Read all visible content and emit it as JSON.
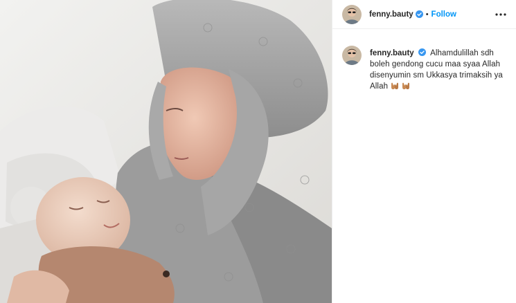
{
  "post": {
    "username": "fenny.bauty",
    "separator": "•",
    "follow_label": "Follow",
    "caption": {
      "username": "fenny.bauty",
      "text": "Alhamdulillah sdh boleh gendong cucu maa syaa Allah disenyumin sm Ukkasya trimaksih ya Allah",
      "emoji_names": [
        "palms-up-together-emoji",
        "palms-up-together-emoji"
      ]
    },
    "icons": {
      "verified": "verified-badge-icon",
      "more": "more-options-icon"
    },
    "colors": {
      "follow": "#0095f6",
      "verified": "#3897f0",
      "border": "#efefef"
    }
  }
}
